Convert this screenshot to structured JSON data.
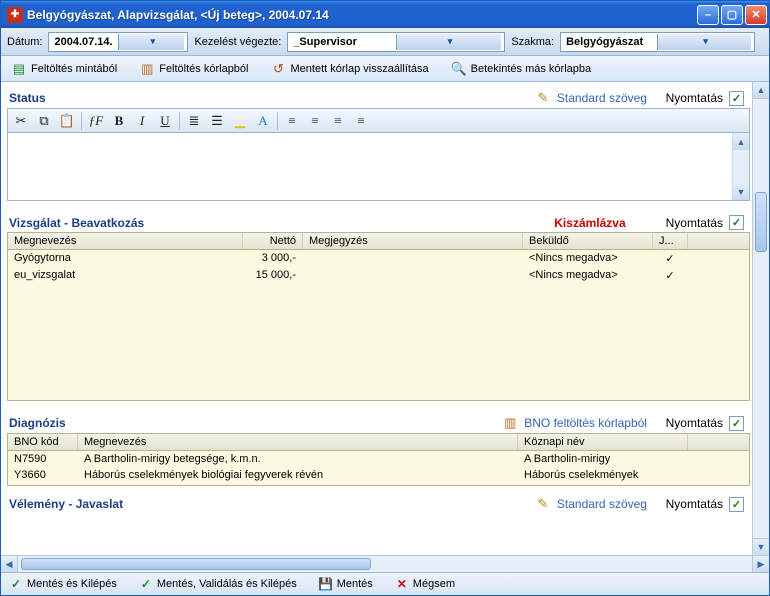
{
  "window": {
    "title": "Belgyógyászat, Alapvizsgálat, <Új beteg>, 2004.07.14"
  },
  "fields": {
    "date_label": "Dátum:",
    "date_value": "2004.07.14.",
    "kezel_label": "Kezelést végezte:",
    "kezel_value": "_Supervisor",
    "szakma_label": "Szakma:",
    "szakma_value": "Belgyógyászat"
  },
  "toolbar": {
    "fill_template": "Feltöltés mintából",
    "fill_korlap": "Feltöltés kórlapból",
    "restore": "Mentett kórlap visszaállítása",
    "view_other": "Betekintés más kórlapba"
  },
  "status_section": {
    "title": "Status",
    "std_text": "Standard szöveg",
    "print": "Nyomtatás",
    "print_checked": true
  },
  "exam_section": {
    "title": "Vizsgálat - Beavatkozás",
    "billed": "Kiszámlázva",
    "print": "Nyomtatás",
    "print_checked": true,
    "columns": {
      "name": "Megnevezés",
      "net": "Nettó",
      "note": "Megjegyzés",
      "sender": "Beküldő",
      "ok": "J..."
    },
    "rows": [
      {
        "name": "Gyógytorna",
        "net": "3 000,-",
        "note": "",
        "sender": "<Nincs megadva>",
        "ok": "✓"
      },
      {
        "name": "eu_vizsgalat",
        "net": "15 000,-",
        "note": "",
        "sender": "<Nincs megadva>",
        "ok": "✓"
      }
    ]
  },
  "diag_section": {
    "title": "Diagnózis",
    "bno_fill": "BNO feltöltés kórlapból",
    "print": "Nyomtatás",
    "print_checked": true,
    "columns": {
      "bno": "BNO kód",
      "name": "Megnevezés",
      "common": "Köznapi név"
    },
    "rows": [
      {
        "bno": "N7590",
        "name": "A Bartholin-mirigy betegsége, k.m.n.",
        "common": "A Bartholin-mirigy"
      },
      {
        "bno": "Y3660",
        "name": "Háborús cselekmények biológiai fegyverek révén",
        "common": "Háborús cselekmények"
      }
    ]
  },
  "opinion_section": {
    "title": "Vélemény - Javaslat",
    "std_text": "Standard szöveg",
    "print": "Nyomtatás",
    "print_checked": true
  },
  "statusbar": {
    "save_exit": "Mentés és Kilépés",
    "save_valid_exit": "Mentés, Validálás és Kilépés",
    "save": "Mentés",
    "cancel": "Mégsem"
  }
}
